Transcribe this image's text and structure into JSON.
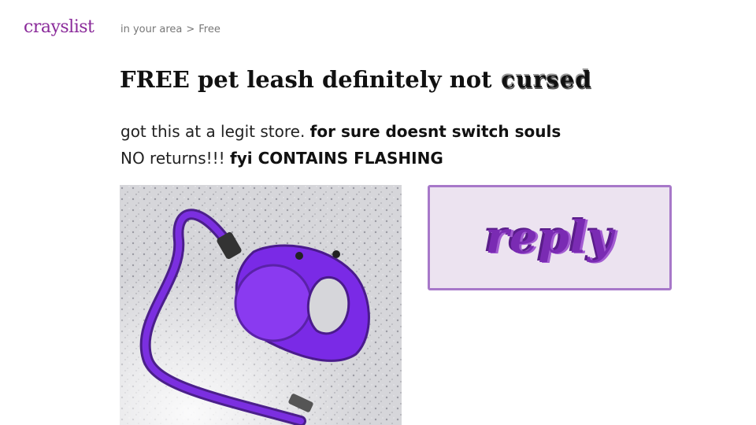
{
  "header": {
    "logo": "crayslist",
    "breadcrumb": {
      "area": "in your area",
      "separator": ">",
      "category": "Free"
    }
  },
  "listing": {
    "title_main": "FREE pet leash definitely not",
    "title_glitch": "cursed",
    "desc_line1_plain": "got this at a legit store. ",
    "desc_line1_bold": "for sure doesnt switch souls",
    "desc_line2_plain": "NO returns!!! ",
    "desc_line2_bold": "fyi CONTAINS FLASHING"
  },
  "reply_button": {
    "label": "reply"
  },
  "colors": {
    "brand": "#8a2a9a",
    "accent": "#7a2bb3",
    "reply_bg": "#ece3f0",
    "reply_border": "#a778c9",
    "leash": "#7b2fe0"
  }
}
